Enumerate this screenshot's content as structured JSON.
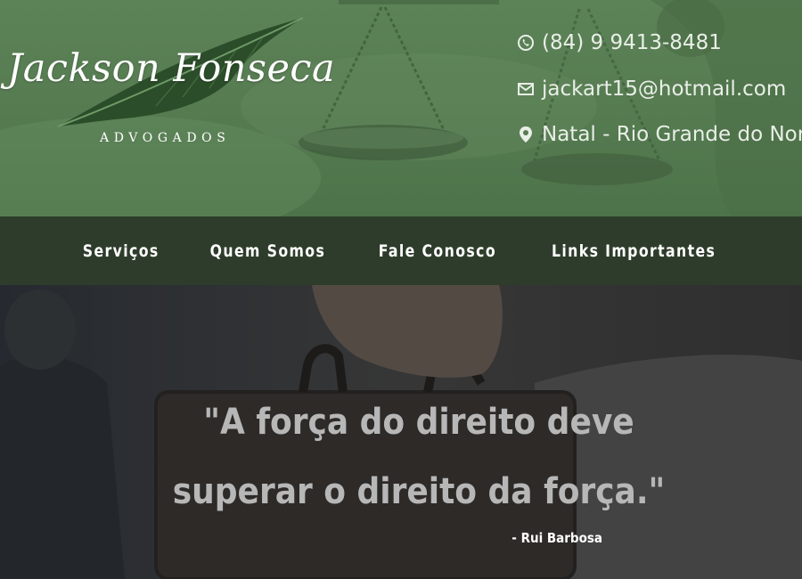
{
  "header": {
    "logo": {
      "name": "Jackson Fonseca",
      "subtitle": "ADVOGADOS"
    },
    "contacts": [
      {
        "icon": "whatsapp-icon",
        "text": "(84) 9 9413-8481"
      },
      {
        "icon": "envelope-icon",
        "text": "jackart15@hotmail.com"
      },
      {
        "icon": "map-pin-icon",
        "text": "Natal - Rio Grande do Norte"
      }
    ]
  },
  "nav": {
    "items": [
      {
        "label": "Serviços"
      },
      {
        "label": "Quem Somos"
      },
      {
        "label": "Fale Conosco"
      },
      {
        "label": "Links Importantes"
      }
    ]
  },
  "hero": {
    "quote_line_1": "\"A força do direito deve",
    "quote_line_2": "superar o direito da força.\"",
    "author": "- Rui Barbosa"
  },
  "colors": {
    "header_green": "#577c52",
    "nav_dark_green": "#2e3d2b",
    "quote_gray": "#b7b7b7"
  }
}
